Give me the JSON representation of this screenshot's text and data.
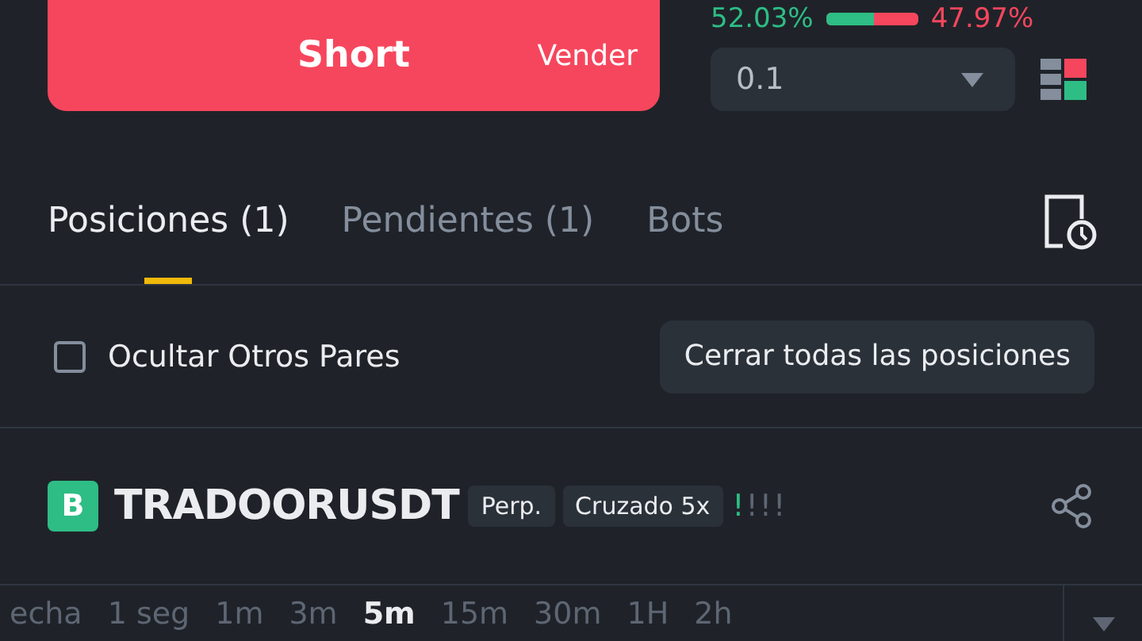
{
  "order": {
    "short_label": "Short",
    "short_sub": "Vender",
    "long_pct": "52.03%",
    "short_pct": "47.97%",
    "ratio": {
      "level": 0.52
    },
    "amount": "0.1"
  },
  "tabs": [
    {
      "label": "Posiciones (1)",
      "selected": true
    },
    {
      "label": "Pendientes (1)",
      "selected": false
    },
    {
      "label": "Bots",
      "selected": false
    }
  ],
  "filter": {
    "label": "Ocultar Otros Pares",
    "checked": false,
    "close_all": "Cerrar todas las posiciones"
  },
  "position": {
    "side": "B",
    "symbol": "TRADOORUSDT",
    "tags": [
      "Perp.",
      "Cruzado 5x"
    ],
    "risk": [
      {
        "mark": "!",
        "lit": true
      },
      {
        "mark": "!",
        "lit": false
      },
      {
        "mark": "!",
        "lit": false
      },
      {
        "mark": "!",
        "lit": false
      }
    ]
  },
  "timeframes": [
    {
      "label": "echa",
      "selected": false
    },
    {
      "label": "1 seg",
      "selected": false
    },
    {
      "label": "1m",
      "selected": false
    },
    {
      "label": "3m",
      "selected": false
    },
    {
      "label": "5m",
      "selected": true
    },
    {
      "label": "15m",
      "selected": false
    },
    {
      "label": "30m",
      "selected": false
    },
    {
      "label": "1H",
      "selected": false
    },
    {
      "label": "2h",
      "selected": false
    }
  ]
}
